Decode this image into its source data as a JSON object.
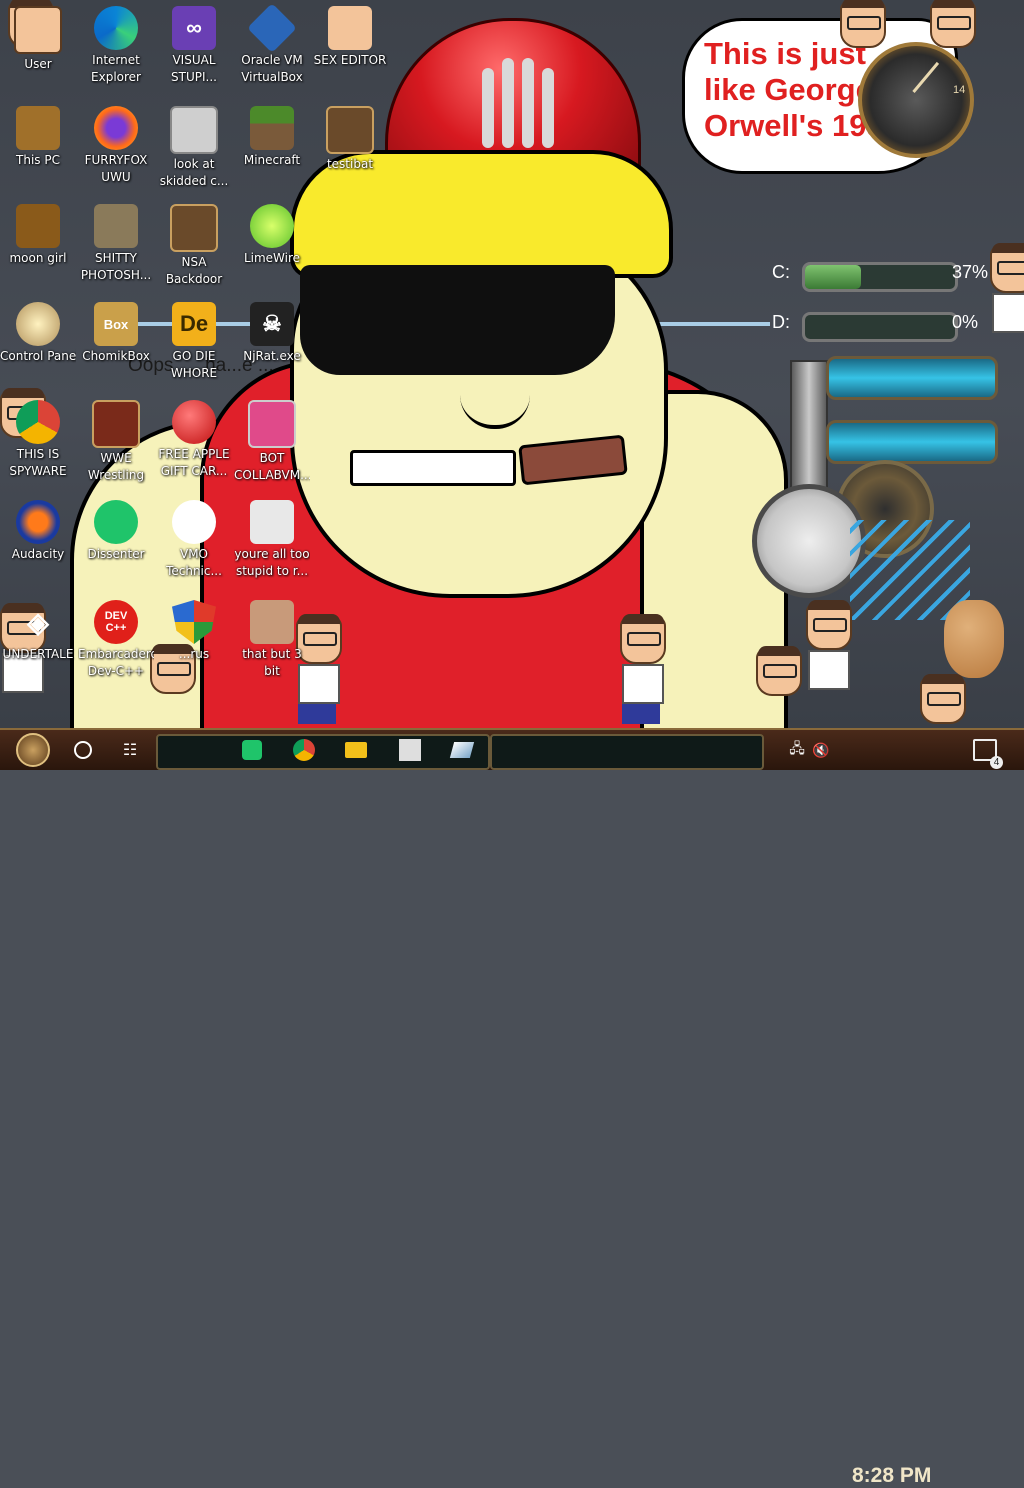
{
  "wallpaper": {
    "caption": "Oops, ... ha...e ... ...s been deemed inap...",
    "speech_bubble": "This is just like George Orwell's 1984"
  },
  "desktop_icons": [
    {
      "label": "User",
      "icon": "user-icon"
    },
    {
      "label": "Internet Explorer",
      "icon": "edge-icon"
    },
    {
      "label": "VISUAL STUPI...",
      "icon": "visual-studio-icon"
    },
    {
      "label": "Oracle VM VirtualBox",
      "icon": "virtualbox-icon"
    },
    {
      "label": "SEX EDITOR",
      "icon": "hank-icon"
    },
    {
      "label": "This PC",
      "icon": "computer-icon"
    },
    {
      "label": "FURRYFOX UWU",
      "icon": "firefox-icon"
    },
    {
      "label": "look at skidded c...",
      "icon": "folder-stack-icon"
    },
    {
      "label": "Minecraft",
      "icon": "minecraft-icon"
    },
    {
      "label": "testibat",
      "icon": "gear-box-icon"
    },
    {
      "label": "moon girl",
      "icon": "box-icon"
    },
    {
      "label": "SHITTY PHOTOSH...",
      "icon": "gimp-icon"
    },
    {
      "label": "NSA Backdoor",
      "icon": "gear-box-icon"
    },
    {
      "label": "LimeWire",
      "icon": "limewire-icon"
    },
    {
      "label": "Control Panel",
      "icon": "bulb-icon"
    },
    {
      "label": "ChomikBox",
      "icon": "chomikbox-icon"
    },
    {
      "label": "GO DIE WHORE",
      "icon": "de-icon"
    },
    {
      "label": "NjRat.exe",
      "icon": "skull-icon"
    },
    {
      "label": "THIS IS SPYWARE",
      "icon": "chrome-icon"
    },
    {
      "label": "WWE Wrestling",
      "icon": "oven-icon"
    },
    {
      "label": "FREE APPLE GIFT CAR...",
      "icon": "apple-icon"
    },
    {
      "label": "BOT COLLABVM...",
      "icon": "monitor-icon"
    },
    {
      "label": "Audacity",
      "icon": "audacity-icon"
    },
    {
      "label": "Dissenter",
      "icon": "dissenter-icon"
    },
    {
      "label": "VMO Technic...",
      "icon": "doctor-icon"
    },
    {
      "label": "youre all too stupid to r...",
      "icon": "portrait-icon"
    },
    {
      "label": "UNDERTALE",
      "icon": "unity-icon"
    },
    {
      "label": "Embarcadero Dev-C++",
      "icon": "devcpp-icon"
    },
    {
      "label": "...rus",
      "icon": "shield-icon"
    },
    {
      "label": "that but 3 bit",
      "icon": "portrait-icon"
    }
  ],
  "widgets": {
    "drives": [
      {
        "letter": "C:",
        "percent": 37,
        "percent_label": "37%"
      },
      {
        "letter": "D:",
        "percent": 0,
        "percent_label": "0%"
      }
    ],
    "clock_numeral": "14"
  },
  "taskbar": {
    "time": "8:28 PM",
    "notification_count": "4",
    "apps": [
      "dissenter-icon",
      "chrome-icon",
      "file-explorer-icon",
      "portrait-icon",
      "gem-icon"
    ]
  },
  "colors": {
    "bubble_text": "#e02020",
    "taskbar": "#2a160c",
    "helmet": "#d71920"
  }
}
